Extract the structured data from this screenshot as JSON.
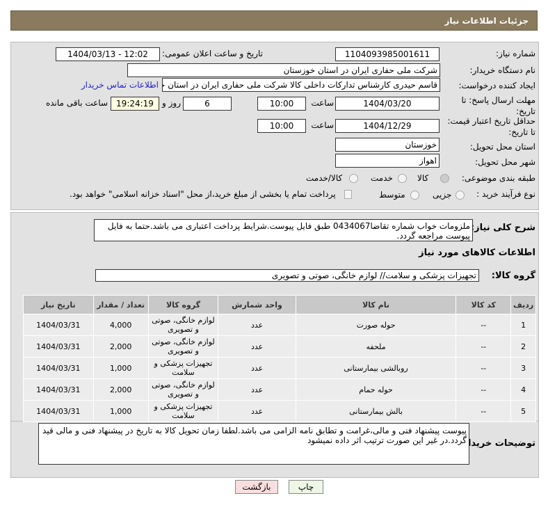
{
  "title": "جزئیات اطلاعات نیاز",
  "fields": {
    "need_number_label": "شماره نیاز:",
    "need_number": "1104093985001611",
    "announce_label": "تاریخ و ساعت اعلان عمومی:",
    "announce": "1404/03/13 - 12:02",
    "buyer_label": "نام دستگاه خریدار:",
    "buyer": "شرکت ملی حفاری ایران در استان خوزستان",
    "creator_label": "ایجاد کننده درخواست:",
    "creator": "قاسم حیدری کارشناس تدارکات داخلی کالا شرکت ملی حفاری ایران در استان خوزستان",
    "contact_link": "اطلاعات تماس خریدار",
    "deadline_label": "مهلت ارسال پاسخ: تا تاریخ:",
    "deadline_date": "1404/03/20",
    "time_label": "ساعت",
    "deadline_time": "10:00",
    "days": "6",
    "days_label": "روز و",
    "remaining": "19:24:19",
    "remaining_label": "ساعت باقی مانده",
    "validity_label": "حداقل تاریخ اعتبار قیمت: تا تاریخ:",
    "validity_date": "1404/12/29",
    "validity_time": "10:00",
    "province_label": "استان محل تحویل:",
    "province": "خوزستان",
    "city_label": "شهر محل تحویل:",
    "city": "اهواز",
    "category_label": "طبقه بندی موضوعی:",
    "cat_options": [
      "کالا",
      "خدمت",
      "کالا/خدمت"
    ],
    "process_label": "نوع فرآیند خرید :",
    "process_options": [
      "جزیی",
      "متوسط"
    ],
    "payment_note": "پرداخت تمام یا بخشی از مبلغ خرید،از محل \"اسناد خزانه اسلامی\" خواهد بود."
  },
  "description_label": "شرح کلی نیاز:",
  "description": "ملزومات خواب شماره تقاضا0434067 طبق فایل پیوست.شرایط پرداخت اعتباری می باشد.حتما به فایل پیوست مراجعه گردد.",
  "goods_title": "اطلاعات کالاهای مورد نیاز",
  "group_label": "گروه کالا:",
  "group": "تجهیزات پزشکی و سلامت// لوازم خانگی، صوتی و تصویری",
  "table": {
    "headers": [
      "ردیف",
      "کد کالا",
      "نام کالا",
      "واحد شمارش",
      "گروه کالا",
      "تعداد / مقدار",
      "تاریخ نیاز"
    ],
    "rows": [
      [
        "1",
        "--",
        "حوله صورت",
        "عدد",
        "لوازم خانگی، صوتی و تصویری",
        "4,000",
        "1404/03/31"
      ],
      [
        "2",
        "--",
        "ملحفه",
        "عدد",
        "لوازم خانگی، صوتی و تصویری",
        "2,000",
        "1404/03/31"
      ],
      [
        "3",
        "--",
        "روبالشی بیمارستانی",
        "عدد",
        "تجهیزات پزشکی و سلامت",
        "1,000",
        "1404/03/31"
      ],
      [
        "4",
        "--",
        "حوله حمام",
        "عدد",
        "لوازم خانگی، صوتی و تصویری",
        "2,000",
        "1404/03/31"
      ],
      [
        "5",
        "--",
        "بالش بیمارستانی",
        "عدد",
        "تجهیزات پزشکی و سلامت",
        "1,000",
        "1404/03/31"
      ]
    ]
  },
  "notes_label": "توضیحات خریدار:",
  "notes": "پیوست پیشنهاد فنی و مالی،غرامت و تطابق نامه الزامی می باشد.لطفا زمان تحویل کالا به تاریخ در پیشنهاد فنی و مالی قید گردد.در غیر این صورت ترتیب اثر داده نمیشود",
  "buttons": {
    "print": "چاپ",
    "back": "بازگشت"
  }
}
